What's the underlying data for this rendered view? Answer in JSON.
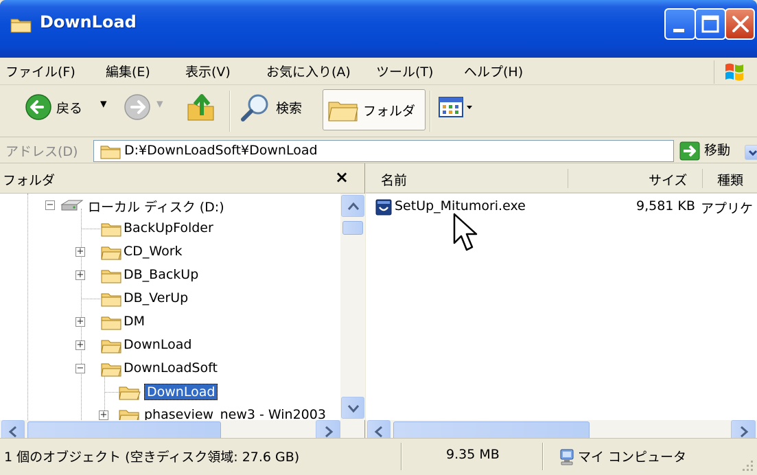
{
  "window": {
    "title": "DownLoad",
    "accent": "#0a4fd8"
  },
  "menu": [
    {
      "label": "ファイル(F)"
    },
    {
      "label": "編集(E)"
    },
    {
      "label": "表示(V)"
    },
    {
      "label": "お気に入り(A)"
    },
    {
      "label": "ツール(T)"
    },
    {
      "label": "ヘルプ(H)"
    }
  ],
  "toolbar": {
    "back_label": "戻る",
    "search_label": "検索",
    "folders_label": "フォルダ"
  },
  "address": {
    "label": "アドレス(D)",
    "value": "D:¥DownLoadSoft¥DownLoad",
    "go_label": "移動"
  },
  "folder_pane": {
    "title": "フォルダ",
    "close": "×",
    "tree": [
      {
        "label": "ローカル ディスク (D:)",
        "expander": "⊟"
      },
      {
        "label": "BackUpFolder",
        "expander": ""
      },
      {
        "label": "CD_Work",
        "expander": "+"
      },
      {
        "label": "DB_BackUp",
        "expander": "+"
      },
      {
        "label": "DB_VerUp",
        "expander": ""
      },
      {
        "label": "DM",
        "expander": "+"
      },
      {
        "label": "DownLoad",
        "expander": "+"
      },
      {
        "label": "DownLoadSoft",
        "expander": "−"
      },
      {
        "label": "DownLoad",
        "expander": ""
      },
      {
        "label": "phaseview_new3 - Win2003",
        "expander": "+"
      }
    ]
  },
  "file_pane": {
    "columns": {
      "name": "名前",
      "size": "サイズ",
      "type": "種類"
    },
    "files": [
      {
        "name": "SetUp_Mitumori.exe",
        "size": "9,581 KB",
        "type": "アプリケ"
      }
    ]
  },
  "status": {
    "objects": "1 個のオブジェクト (空きディスク領域: 27.6 GB)",
    "size": "9.35 MB",
    "location": "マイ コンピュータ"
  }
}
